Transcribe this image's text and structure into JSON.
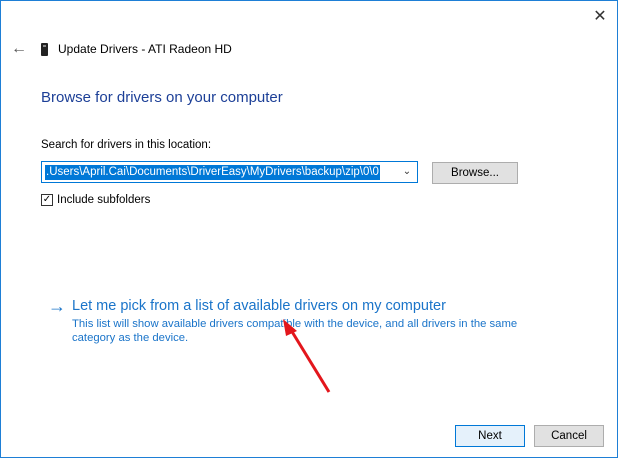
{
  "window": {
    "close_glyph": "✕"
  },
  "header": {
    "back_glyph": "←",
    "title": "Update Drivers - ATI Radeon HD"
  },
  "main": {
    "heading": "Browse for drivers on your computer",
    "search_label": "Search for drivers in this location:",
    "path_value": ".Users\\April.Cai\\Documents\\DriverEasy\\MyDrivers\\backup\\zip\\0\\0",
    "browse_label": "Browse...",
    "include_subfolders_label": "Include subfolders",
    "include_subfolders_checked": true,
    "pick_arrow_glyph": "→",
    "pick_title": "Let me pick from a list of available drivers on my computer",
    "pick_description": "This list will show available drivers compatible with the device, and all drivers in the same category as the device."
  },
  "footer": {
    "next_label": "Next",
    "cancel_label": "Cancel"
  },
  "colors": {
    "accent": "#0078d7",
    "heading": "#1c3f97",
    "link": "#1a74c9",
    "annotation_arrow": "#e3161c"
  }
}
